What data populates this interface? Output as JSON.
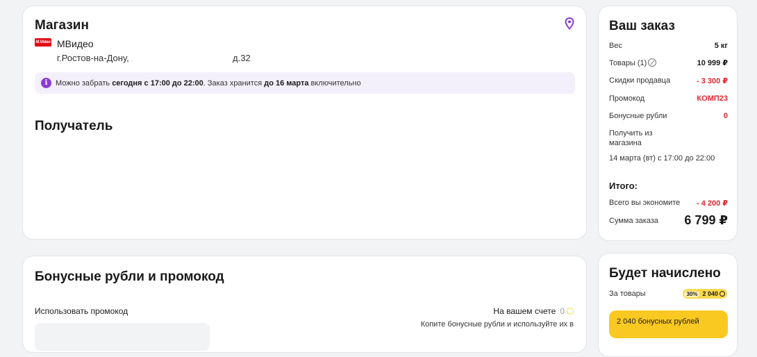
{
  "store": {
    "title": "Магазин",
    "icon": "map-pin-icon",
    "brand_color": "#e30613",
    "logo_text": "M.Video",
    "name": "МВидео",
    "address_city": "г.Ростов-на-Дону,",
    "address_house": "д.32",
    "pickup_info": {
      "prefix": "Можно забрать",
      "time_bold": "сегодня с 17:00 до 22:00",
      "middle": ". Заказ хранится",
      "until_bold": "до 16 марта",
      "suffix": "включительно"
    }
  },
  "recipient": {
    "title": "Получатель"
  },
  "bonus": {
    "title": "Бонусные рубли и промокод",
    "use_promo_label": "Использовать промокод",
    "balance_label": "На вашем счете",
    "balance_value": "0",
    "hint": "Копите бонусные рубли и используйте их в"
  },
  "order": {
    "title": "Ваш заказ",
    "weight_label": "Вес",
    "weight_value": "5 кг",
    "items_label": "Товары (1)",
    "items_value": "10 999 ₽",
    "discount_label": "Скидки продавца",
    "discount_value": "- 3 300 ₽",
    "promo_label": "Промокод",
    "promo_value": "КОМП23",
    "bonus_label": "Бонусные рубли",
    "bonus_value": "0",
    "pickup_label": "Получить из магазина",
    "pickup_time": "14 марта (вт)  с 17:00 до 22:00",
    "total_title": "Итого:",
    "savings_label": "Всего вы экономите",
    "savings_value": "- 4 200 ₽",
    "sum_label": "Сумма заказа",
    "sum_value": "6 799 ₽",
    "accent_red": "#e0262e"
  },
  "accrual": {
    "title": "Будет начислено",
    "for_items_label": "За товары",
    "percent": "30%",
    "amount": "2 040",
    "button_text": "2 040 бонусных рублей",
    "accent_yellow": "#f9c821"
  }
}
